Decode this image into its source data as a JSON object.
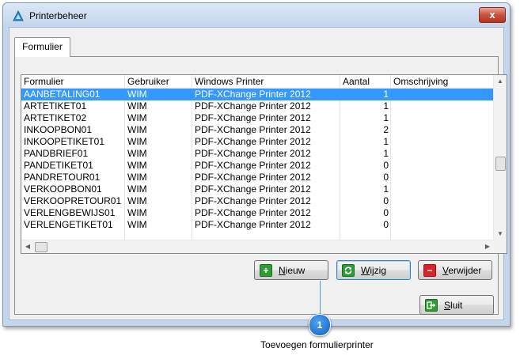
{
  "window": {
    "title": "Printerbeheer",
    "close_glyph": "x"
  },
  "tab": {
    "label": "Formulier"
  },
  "table": {
    "columns": [
      "Formulier",
      "Gebruiker",
      "Windows Printer",
      "Aantal",
      "Omschrijving"
    ],
    "rows": [
      [
        "AANBETALING01",
        "WIM",
        "PDF-XChange Printer 2012",
        "1",
        ""
      ],
      [
        "ARTETIKET01",
        "WIM",
        "PDF-XChange Printer 2012",
        "1",
        ""
      ],
      [
        "ARTETIKET02",
        "WIM",
        "PDF-XChange Printer 2012",
        "1",
        ""
      ],
      [
        "INKOOPBON01",
        "WIM",
        "PDF-XChange Printer 2012",
        "2",
        ""
      ],
      [
        "INKOOPETIKET01",
        "WIM",
        "PDF-XChange Printer 2012",
        "1",
        ""
      ],
      [
        "PANDBRIEF01",
        "WIM",
        "PDF-XChange Printer 2012",
        "1",
        ""
      ],
      [
        "PANDETIKET01",
        "WIM",
        "PDF-XChange Printer 2012",
        "0",
        ""
      ],
      [
        "PANDRETOUR01",
        "WIM",
        "PDF-XChange Printer 2012",
        "0",
        ""
      ],
      [
        "VERKOOPBON01",
        "WIM",
        "PDF-XChange Printer 2012",
        "1",
        ""
      ],
      [
        "VERKOOPRETOUR01",
        "WIM",
        "PDF-XChange Printer 2012",
        "0",
        ""
      ],
      [
        "VERLENGBEWIJS01",
        "WIM",
        "PDF-XChange Printer 2012",
        "0",
        ""
      ],
      [
        "VERLENGETIKET01",
        "WIM",
        "PDF-XChange Printer 2012",
        "0",
        ""
      ]
    ],
    "selected_row": "AANBETALING01"
  },
  "buttons": {
    "nieuw": {
      "access_key": "N",
      "rest": "ieuw",
      "icon": "plus-icon"
    },
    "wijzig": {
      "access_key": "W",
      "rest": "ijzig",
      "icon": "refresh-icon"
    },
    "verwijder": {
      "access_key": "V",
      "rest": "erwijder",
      "icon": "minus-icon"
    },
    "sluit": {
      "access_key": "S",
      "rest": "luit",
      "icon": "exit-icon"
    }
  },
  "callout": {
    "number": "1",
    "text": "Toevoegen formulierprinter"
  },
  "colors": {
    "selection": "#3399ff",
    "accent": "#1462c1"
  }
}
